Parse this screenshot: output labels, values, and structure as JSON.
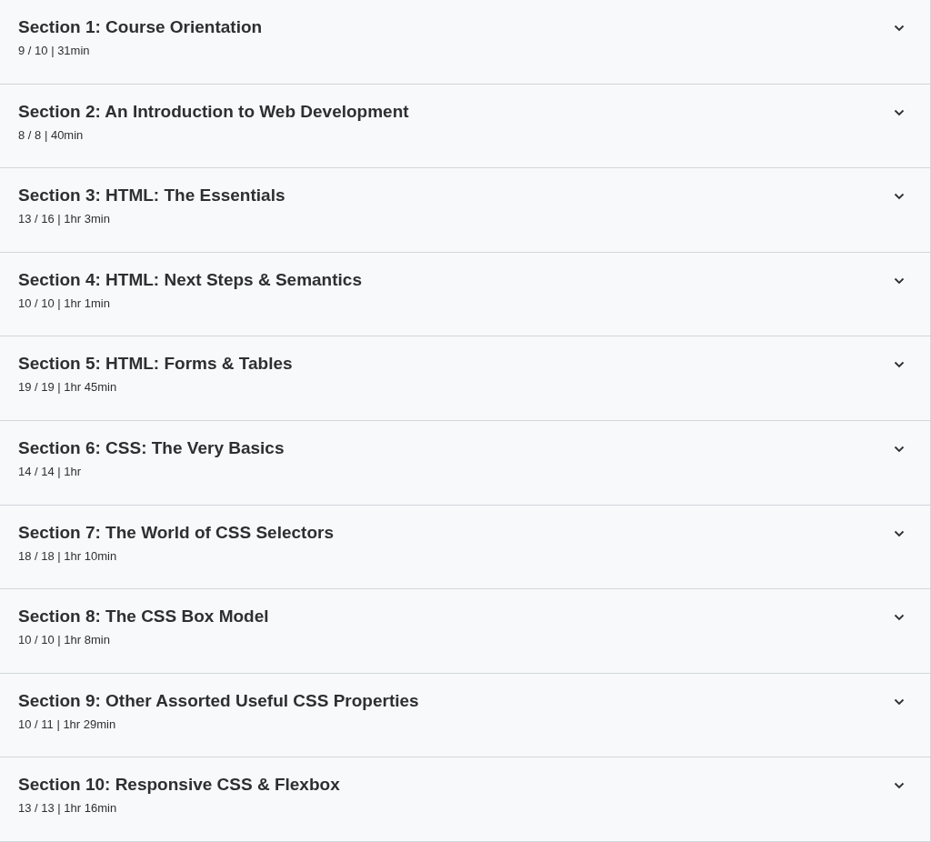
{
  "sections": [
    {
      "title": "Section 1: Course Orientation",
      "meta": "9 / 10 | 31min",
      "expanded": false
    },
    {
      "title": "Section 2: An Introduction to Web Development",
      "meta": "8 / 8 | 40min",
      "expanded": false
    },
    {
      "title": "Section 3: HTML: The Essentials",
      "meta": "13 / 16 | 1hr 3min",
      "expanded": false
    },
    {
      "title": "Section 4: HTML: Next Steps & Semantics",
      "meta": "10 / 10 | 1hr 1min",
      "expanded": false
    },
    {
      "title": "Section 5: HTML: Forms & Tables",
      "meta": "19 / 19 | 1hr 45min",
      "expanded": false
    },
    {
      "title": "Section 6: CSS: The Very Basics",
      "meta": "14 / 14 | 1hr",
      "expanded": false
    },
    {
      "title": "Section 7: The World of CSS Selectors",
      "meta": "18 / 18 | 1hr 10min",
      "expanded": false
    },
    {
      "title": "Section 8: The CSS Box Model",
      "meta": "10 / 10 | 1hr 8min",
      "expanded": false
    },
    {
      "title": "Section 9: Other Assorted Useful CSS Properties",
      "meta": "10 / 11 | 1hr 29min",
      "expanded": false
    },
    {
      "title": "Section 10: Responsive CSS & Flexbox",
      "meta": "13 / 13 | 1hr 16min",
      "expanded": false
    }
  ]
}
